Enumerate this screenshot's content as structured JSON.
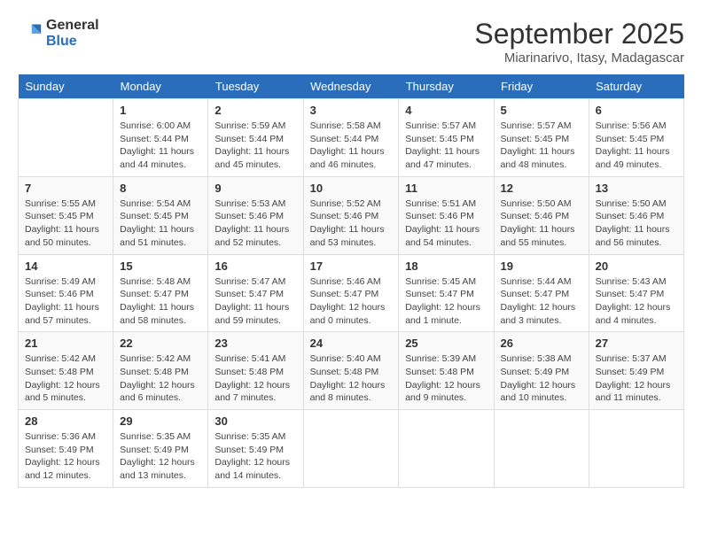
{
  "logo": {
    "line1": "General",
    "line2": "Blue"
  },
  "title": "September 2025",
  "location": "Miarinarivo, Itasy, Madagascar",
  "days_of_week": [
    "Sunday",
    "Monday",
    "Tuesday",
    "Wednesday",
    "Thursday",
    "Friday",
    "Saturday"
  ],
  "weeks": [
    [
      {
        "day": "",
        "sunrise": "",
        "sunset": "",
        "daylight": ""
      },
      {
        "day": "1",
        "sunrise": "Sunrise: 6:00 AM",
        "sunset": "Sunset: 5:44 PM",
        "daylight": "Daylight: 11 hours and 44 minutes."
      },
      {
        "day": "2",
        "sunrise": "Sunrise: 5:59 AM",
        "sunset": "Sunset: 5:44 PM",
        "daylight": "Daylight: 11 hours and 45 minutes."
      },
      {
        "day": "3",
        "sunrise": "Sunrise: 5:58 AM",
        "sunset": "Sunset: 5:44 PM",
        "daylight": "Daylight: 11 hours and 46 minutes."
      },
      {
        "day": "4",
        "sunrise": "Sunrise: 5:57 AM",
        "sunset": "Sunset: 5:45 PM",
        "daylight": "Daylight: 11 hours and 47 minutes."
      },
      {
        "day": "5",
        "sunrise": "Sunrise: 5:57 AM",
        "sunset": "Sunset: 5:45 PM",
        "daylight": "Daylight: 11 hours and 48 minutes."
      },
      {
        "day": "6",
        "sunrise": "Sunrise: 5:56 AM",
        "sunset": "Sunset: 5:45 PM",
        "daylight": "Daylight: 11 hours and 49 minutes."
      }
    ],
    [
      {
        "day": "7",
        "sunrise": "Sunrise: 5:55 AM",
        "sunset": "Sunset: 5:45 PM",
        "daylight": "Daylight: 11 hours and 50 minutes."
      },
      {
        "day": "8",
        "sunrise": "Sunrise: 5:54 AM",
        "sunset": "Sunset: 5:45 PM",
        "daylight": "Daylight: 11 hours and 51 minutes."
      },
      {
        "day": "9",
        "sunrise": "Sunrise: 5:53 AM",
        "sunset": "Sunset: 5:46 PM",
        "daylight": "Daylight: 11 hours and 52 minutes."
      },
      {
        "day": "10",
        "sunrise": "Sunrise: 5:52 AM",
        "sunset": "Sunset: 5:46 PM",
        "daylight": "Daylight: 11 hours and 53 minutes."
      },
      {
        "day": "11",
        "sunrise": "Sunrise: 5:51 AM",
        "sunset": "Sunset: 5:46 PM",
        "daylight": "Daylight: 11 hours and 54 minutes."
      },
      {
        "day": "12",
        "sunrise": "Sunrise: 5:50 AM",
        "sunset": "Sunset: 5:46 PM",
        "daylight": "Daylight: 11 hours and 55 minutes."
      },
      {
        "day": "13",
        "sunrise": "Sunrise: 5:50 AM",
        "sunset": "Sunset: 5:46 PM",
        "daylight": "Daylight: 11 hours and 56 minutes."
      }
    ],
    [
      {
        "day": "14",
        "sunrise": "Sunrise: 5:49 AM",
        "sunset": "Sunset: 5:46 PM",
        "daylight": "Daylight: 11 hours and 57 minutes."
      },
      {
        "day": "15",
        "sunrise": "Sunrise: 5:48 AM",
        "sunset": "Sunset: 5:47 PM",
        "daylight": "Daylight: 11 hours and 58 minutes."
      },
      {
        "day": "16",
        "sunrise": "Sunrise: 5:47 AM",
        "sunset": "Sunset: 5:47 PM",
        "daylight": "Daylight: 11 hours and 59 minutes."
      },
      {
        "day": "17",
        "sunrise": "Sunrise: 5:46 AM",
        "sunset": "Sunset: 5:47 PM",
        "daylight": "Daylight: 12 hours and 0 minutes."
      },
      {
        "day": "18",
        "sunrise": "Sunrise: 5:45 AM",
        "sunset": "Sunset: 5:47 PM",
        "daylight": "Daylight: 12 hours and 1 minute."
      },
      {
        "day": "19",
        "sunrise": "Sunrise: 5:44 AM",
        "sunset": "Sunset: 5:47 PM",
        "daylight": "Daylight: 12 hours and 3 minutes."
      },
      {
        "day": "20",
        "sunrise": "Sunrise: 5:43 AM",
        "sunset": "Sunset: 5:47 PM",
        "daylight": "Daylight: 12 hours and 4 minutes."
      }
    ],
    [
      {
        "day": "21",
        "sunrise": "Sunrise: 5:42 AM",
        "sunset": "Sunset: 5:48 PM",
        "daylight": "Daylight: 12 hours and 5 minutes."
      },
      {
        "day": "22",
        "sunrise": "Sunrise: 5:42 AM",
        "sunset": "Sunset: 5:48 PM",
        "daylight": "Daylight: 12 hours and 6 minutes."
      },
      {
        "day": "23",
        "sunrise": "Sunrise: 5:41 AM",
        "sunset": "Sunset: 5:48 PM",
        "daylight": "Daylight: 12 hours and 7 minutes."
      },
      {
        "day": "24",
        "sunrise": "Sunrise: 5:40 AM",
        "sunset": "Sunset: 5:48 PM",
        "daylight": "Daylight: 12 hours and 8 minutes."
      },
      {
        "day": "25",
        "sunrise": "Sunrise: 5:39 AM",
        "sunset": "Sunset: 5:48 PM",
        "daylight": "Daylight: 12 hours and 9 minutes."
      },
      {
        "day": "26",
        "sunrise": "Sunrise: 5:38 AM",
        "sunset": "Sunset: 5:49 PM",
        "daylight": "Daylight: 12 hours and 10 minutes."
      },
      {
        "day": "27",
        "sunrise": "Sunrise: 5:37 AM",
        "sunset": "Sunset: 5:49 PM",
        "daylight": "Daylight: 12 hours and 11 minutes."
      }
    ],
    [
      {
        "day": "28",
        "sunrise": "Sunrise: 5:36 AM",
        "sunset": "Sunset: 5:49 PM",
        "daylight": "Daylight: 12 hours and 12 minutes."
      },
      {
        "day": "29",
        "sunrise": "Sunrise: 5:35 AM",
        "sunset": "Sunset: 5:49 PM",
        "daylight": "Daylight: 12 hours and 13 minutes."
      },
      {
        "day": "30",
        "sunrise": "Sunrise: 5:35 AM",
        "sunset": "Sunset: 5:49 PM",
        "daylight": "Daylight: 12 hours and 14 minutes."
      },
      {
        "day": "",
        "sunrise": "",
        "sunset": "",
        "daylight": ""
      },
      {
        "day": "",
        "sunrise": "",
        "sunset": "",
        "daylight": ""
      },
      {
        "day": "",
        "sunrise": "",
        "sunset": "",
        "daylight": ""
      },
      {
        "day": "",
        "sunrise": "",
        "sunset": "",
        "daylight": ""
      }
    ]
  ]
}
